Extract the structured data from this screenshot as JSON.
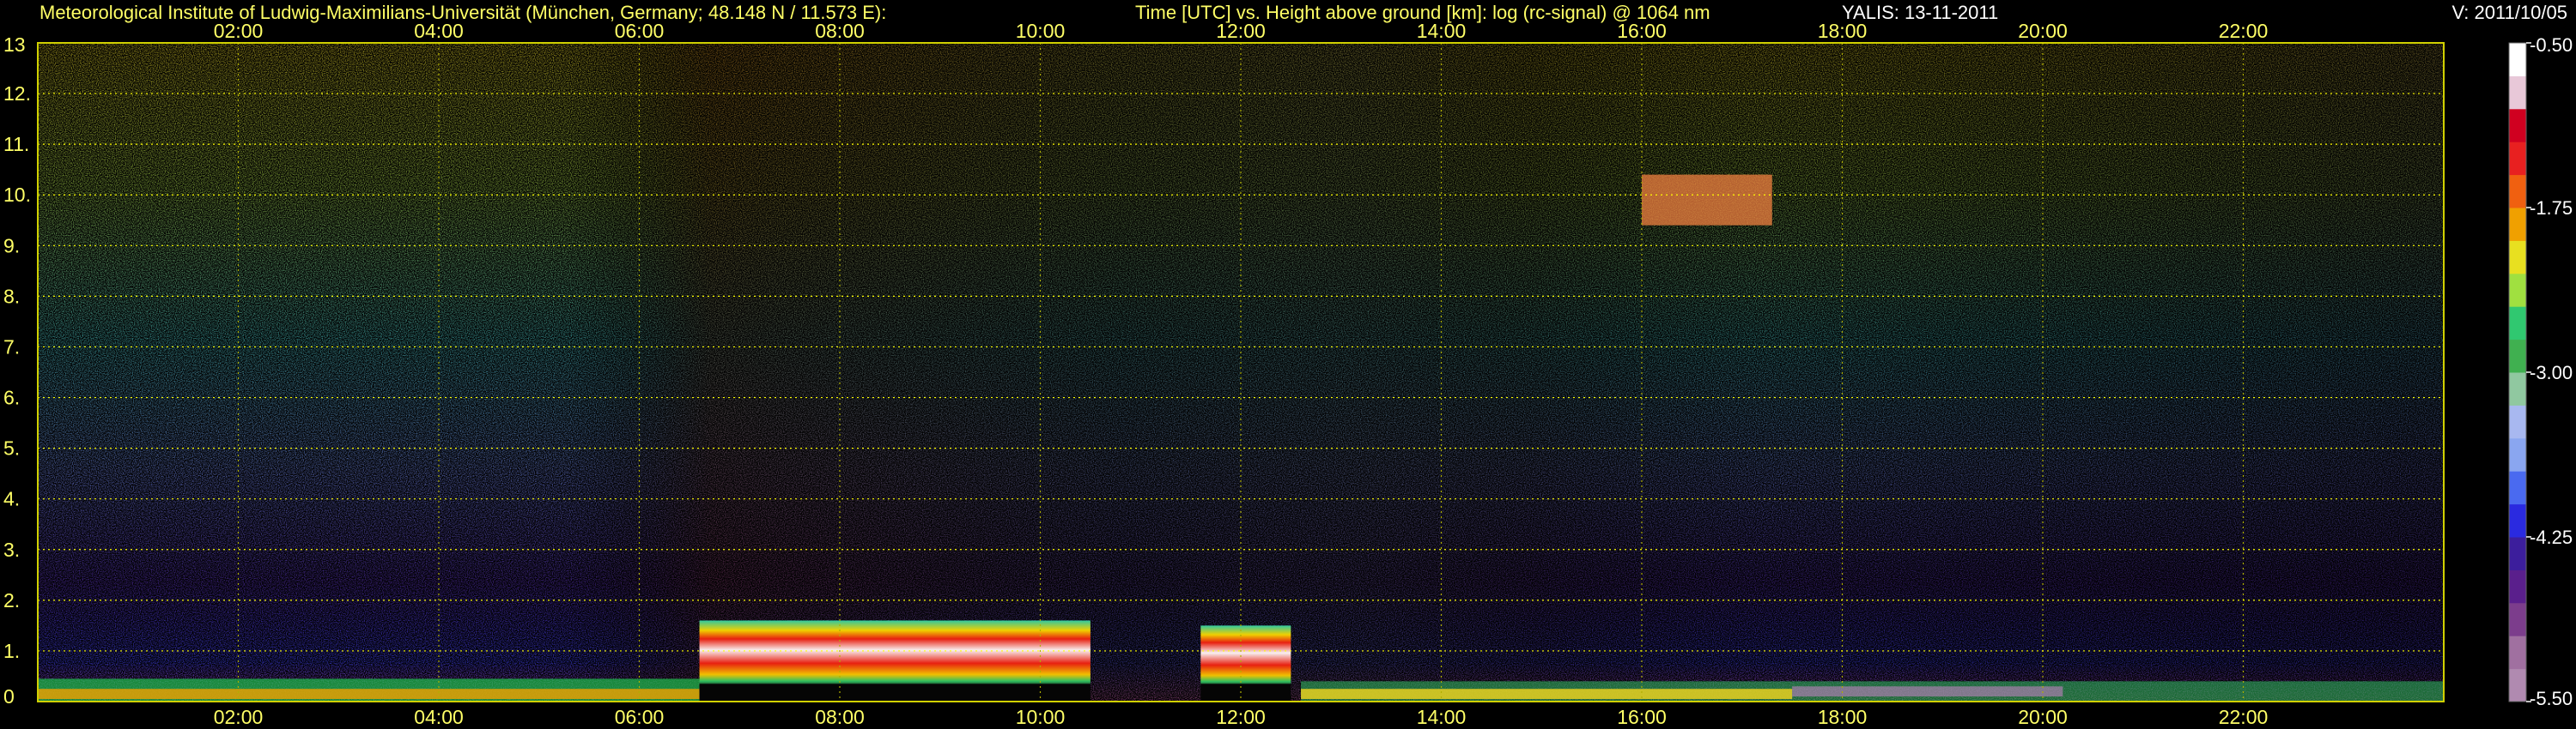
{
  "chart_data": {
    "type": "heatmap",
    "header": {
      "institute": "Meteorological Institute of Ludwig-Maximilians-Universität (München, Germany; 48.148 N / 11.573 E):",
      "description": "Time [UTC] vs. Height above ground [km]: log (rc-signal) @ 1064 nm",
      "instrument_date": "YALIS: 13-11-2011",
      "version": "V: 2011/10/05"
    },
    "x_axis": {
      "unit": "UTC hour",
      "range": [
        0,
        24
      ],
      "ticks": [
        {
          "value": 2,
          "label": "02:00"
        },
        {
          "value": 4,
          "label": "04:00"
        },
        {
          "value": 6,
          "label": "06:00"
        },
        {
          "value": 8,
          "label": "08:00"
        },
        {
          "value": 10,
          "label": "10:00"
        },
        {
          "value": 12,
          "label": "12:00"
        },
        {
          "value": 14,
          "label": "14:00"
        },
        {
          "value": 16,
          "label": "16:00"
        },
        {
          "value": 18,
          "label": "18:00"
        },
        {
          "value": 20,
          "label": "20:00"
        },
        {
          "value": 22,
          "label": "22:00"
        }
      ]
    },
    "y_axis": {
      "unit": "km",
      "range": [
        0,
        13
      ],
      "ticks": [
        {
          "value": 0,
          "label": "0"
        },
        {
          "value": 1,
          "label": "1."
        },
        {
          "value": 2,
          "label": "2."
        },
        {
          "value": 3,
          "label": "3."
        },
        {
          "value": 4,
          "label": "4."
        },
        {
          "value": 5,
          "label": "5."
        },
        {
          "value": 6,
          "label": "6."
        },
        {
          "value": 7,
          "label": "7."
        },
        {
          "value": 8,
          "label": "8."
        },
        {
          "value": 9,
          "label": "9."
        },
        {
          "value": 10,
          "label": "10."
        },
        {
          "value": 11,
          "label": "11."
        },
        {
          "value": 12,
          "label": "12."
        },
        {
          "value": 13,
          "label": "13"
        }
      ]
    },
    "colorbar": {
      "scale": "log",
      "range": [
        -5.5,
        -0.5
      ],
      "ticks": [
        {
          "value": -0.5,
          "label": "-0.50"
        },
        {
          "value": -1.75,
          "label": "-1.75"
        },
        {
          "value": -3.0,
          "label": "-3.00"
        },
        {
          "value": -4.25,
          "label": "-4.25"
        },
        {
          "value": -5.5,
          "label": "-5.50"
        }
      ],
      "colors": [
        "#b08ab0",
        "#a070a0",
        "#7c3d8c",
        "#5a1f8c",
        "#3c1e9c",
        "#2a2ae0",
        "#4a6af0",
        "#8aa6f0",
        "#a8b8f0",
        "#90c8a0",
        "#40b050",
        "#30c870",
        "#a0e040",
        "#e8e020",
        "#f0a000",
        "#f06010",
        "#e82020",
        "#d00020",
        "#e8c8d8",
        "#ffffff"
      ]
    },
    "cloud_layer": {
      "note": "dense aerosol/cloud layer near 1 km from about 06:00 to 12:30 UTC",
      "segments": [
        {
          "start": 6.6,
          "end": 10.5,
          "base_km": 0.3,
          "top_km": 1.6
        },
        {
          "start": 11.6,
          "end": 12.5,
          "base_km": 0.3,
          "top_km": 1.5
        }
      ]
    },
    "cirrus": {
      "note": "thin cirrus near 9.5–10.5 km around 16:30 UTC",
      "start": 16.0,
      "end": 17.3,
      "base_km": 9.4,
      "top_km": 10.4
    },
    "colors": {
      "text": "#ffff66",
      "grid_time": "#b0b000",
      "grid_height": "#ffff00",
      "frame": "#d0d000"
    }
  }
}
